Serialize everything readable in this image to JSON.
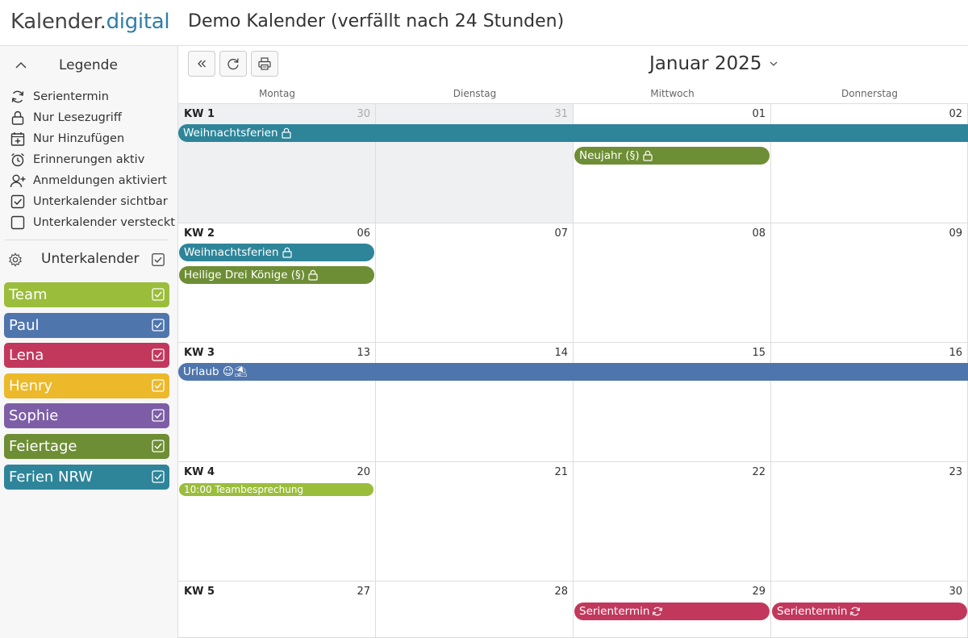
{
  "header": {
    "logo_main": "Kalender.",
    "logo_accent": "digital",
    "title": "Demo Kalender (verfällt nach 24 Stunden)"
  },
  "legend": {
    "title": "Legende",
    "items": [
      {
        "label": "Serientermin",
        "icon": "recurring-icon"
      },
      {
        "label": "Nur Lesezugriff",
        "icon": "lock-icon"
      },
      {
        "label": "Nur Hinzufügen",
        "icon": "add-calendar-icon"
      },
      {
        "label": "Erinnerungen aktiv",
        "icon": "alarm-icon"
      },
      {
        "label": "Anmeldungen aktiviert",
        "icon": "add-user-icon"
      },
      {
        "label": "Unterkalender sichtbar",
        "icon": "checkbox-checked-icon"
      },
      {
        "label": "Unterkalender versteckt",
        "icon": "checkbox-empty-icon"
      }
    ]
  },
  "subcalendars": {
    "title": "Unterkalender",
    "items": [
      {
        "label": "Team",
        "color": "#9bbd3c"
      },
      {
        "label": "Paul",
        "color": "#4f75ad"
      },
      {
        "label": "Lena",
        "color": "#c2385d"
      },
      {
        "label": "Henry",
        "color": "#ecb92b"
      },
      {
        "label": "Sophie",
        "color": "#7d5ea6"
      },
      {
        "label": "Feiertage",
        "color": "#6e8e35"
      },
      {
        "label": "Ferien NRW",
        "color": "#2e8599"
      }
    ]
  },
  "toolbar": {
    "month_label": "Januar 2025"
  },
  "days": [
    "Montag",
    "Dienstag",
    "Mittwoch",
    "Donnerstag"
  ],
  "weeks": [
    {
      "kw": "KW 1",
      "dates": [
        "30",
        "31",
        "01",
        "02"
      ],
      "dim": [
        true,
        true,
        false,
        false
      ]
    },
    {
      "kw": "KW 2",
      "dates": [
        "06",
        "07",
        "08",
        "09"
      ],
      "dim": [
        false,
        false,
        false,
        false
      ]
    },
    {
      "kw": "KW 3",
      "dates": [
        "13",
        "14",
        "15",
        "16"
      ],
      "dim": [
        false,
        false,
        false,
        false
      ]
    },
    {
      "kw": "KW 4",
      "dates": [
        "20",
        "21",
        "22",
        "23"
      ],
      "dim": [
        false,
        false,
        false,
        false
      ]
    },
    {
      "kw": "KW 5",
      "dates": [
        "27",
        "28",
        "29",
        "30"
      ],
      "dim": [
        false,
        false,
        false,
        false
      ]
    }
  ],
  "events": {
    "w1_ferien": "Weihnachtsferien",
    "w1_neujahr": "Neujahr (§)",
    "w2_ferien": "Weihnachtsferien",
    "w2_koenige": "Heilige Drei Könige (§)",
    "w3_urlaub": "Urlaub 😉⛱",
    "w4_team": "10:00 Teambesprechung",
    "w5_serie1": "Serientermin",
    "w5_serie2": "Serientermin"
  }
}
